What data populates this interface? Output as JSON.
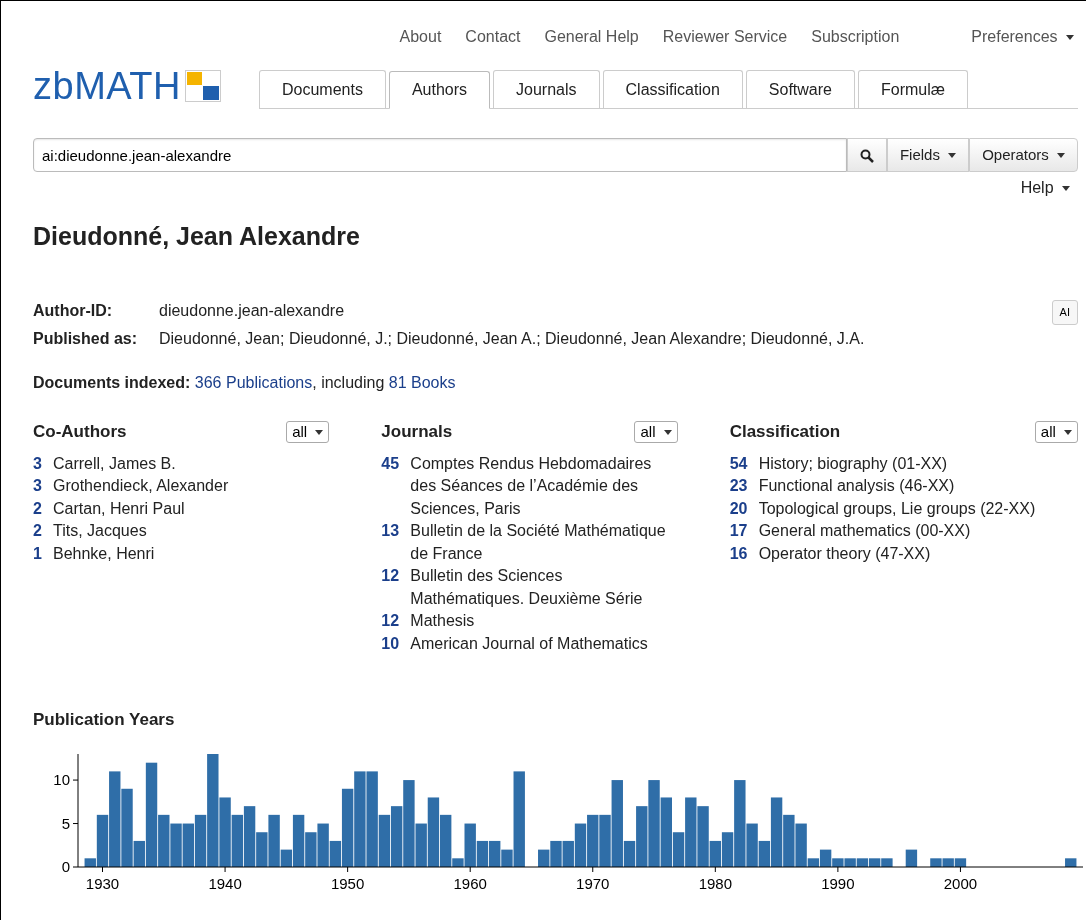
{
  "top_links": [
    "About",
    "Contact",
    "General Help",
    "Reviewer Service",
    "Subscription"
  ],
  "preferences": "Preferences",
  "logo": "zbMATH",
  "tabs": [
    {
      "label": "Documents",
      "selected": false
    },
    {
      "label": "Authors",
      "selected": true
    },
    {
      "label": "Journals",
      "selected": false
    },
    {
      "label": "Classification",
      "selected": false
    },
    {
      "label": "Software",
      "selected": false
    },
    {
      "label": "Formulæ",
      "selected": false
    }
  ],
  "search": {
    "value": "ai:dieudonne.jean-alexandre",
    "buttons": [
      "Fields",
      "Operators"
    ],
    "help": "Help"
  },
  "author": {
    "name": "Dieudonné, Jean Alexandre",
    "fields": [
      {
        "label": "Author-ID:",
        "value": "dieudonne.jean-alexandre"
      },
      {
        "label": "Published as:",
        "value": "Dieudonné, Jean; Dieudonné, J.; Dieudonné, Jean A.; Dieudonné, Jean Alexandre; Dieudonné, J.A."
      }
    ],
    "ai_button": "AI",
    "documents": {
      "label": "Documents indexed:",
      "publications": "366 Publications",
      "middle": ", including",
      "books": "81 Books"
    }
  },
  "columns": [
    {
      "title": "Co-Authors",
      "filter": "all",
      "items": [
        {
          "count": "3",
          "text": "Carrell, James B."
        },
        {
          "count": "3",
          "text": "Grothendieck, Alexander"
        },
        {
          "count": "2",
          "text": "Cartan, Henri Paul"
        },
        {
          "count": "2",
          "text": "Tits, Jacques"
        },
        {
          "count": "1",
          "text": "Behnke, Henri"
        }
      ]
    },
    {
      "title": "Journals",
      "filter": "all",
      "items": [
        {
          "count": "45",
          "text": "Comptes Rendus Hebdomadaires des Séances de l’Académie des Sciences, Paris"
        },
        {
          "count": "13",
          "text": "Bulletin de la Société Mathématique de France"
        },
        {
          "count": "12",
          "text": "Bulletin des Sciences Mathématiques. Deuxième Série"
        },
        {
          "count": "12",
          "text": "Mathesis"
        },
        {
          "count": "10",
          "text": "American Journal of Mathematics"
        }
      ]
    },
    {
      "title": "Classification",
      "filter": "all",
      "items": [
        {
          "count": "54",
          "text": "History; biography (01-XX)"
        },
        {
          "count": "23",
          "text": "Functional analysis (46-XX)"
        },
        {
          "count": "20",
          "text": "Topological groups, Lie groups (22-XX)"
        },
        {
          "count": "17",
          "text": "General mathematics (00-XX)"
        },
        {
          "count": "16",
          "text": "Operator theory (47-XX)"
        }
      ]
    }
  ],
  "publication_years": {
    "chart_data": {
      "type": "bar",
      "title": "Publication Years",
      "x": [
        1929,
        1930,
        1931,
        1932,
        1933,
        1934,
        1935,
        1936,
        1937,
        1938,
        1939,
        1940,
        1941,
        1942,
        1943,
        1944,
        1945,
        1946,
        1947,
        1948,
        1949,
        1950,
        1951,
        1952,
        1953,
        1954,
        1955,
        1956,
        1957,
        1958,
        1959,
        1960,
        1961,
        1962,
        1963,
        1964,
        1965,
        1966,
        1967,
        1968,
        1969,
        1970,
        1971,
        1972,
        1973,
        1974,
        1975,
        1976,
        1977,
        1978,
        1979,
        1980,
        1981,
        1982,
        1983,
        1984,
        1985,
        1986,
        1987,
        1988,
        1989,
        1990,
        1991,
        1992,
        1993,
        1994,
        1995,
        1996,
        1997,
        1998,
        1999,
        2000,
        2001,
        2002,
        2003,
        2004,
        2005,
        2006,
        2007,
        2008,
        2009
      ],
      "series": [
        {
          "color": "#2f6ea8",
          "values": [
            1,
            6,
            11,
            9,
            3,
            12,
            6,
            5,
            5,
            6,
            13,
            8,
            6,
            7,
            4,
            6,
            2,
            6,
            4,
            5,
            3,
            9,
            11,
            11,
            6,
            7,
            10,
            5,
            8,
            6,
            1,
            5,
            3,
            3,
            2,
            11,
            0,
            2,
            3,
            3,
            5,
            6,
            6,
            10,
            3,
            7,
            10,
            8,
            4,
            8,
            7,
            3,
            4,
            10,
            5,
            3,
            8,
            6,
            5,
            1,
            2,
            1,
            1,
            1,
            1,
            1,
            0,
            2,
            0,
            1,
            1,
            1,
            0,
            0,
            0,
            0,
            0,
            0,
            0,
            0,
            1
          ]
        }
      ],
      "xlim": [
        1928,
        2010
      ],
      "ylim": [
        0,
        13
      ],
      "yticks": [
        0,
        5,
        10
      ],
      "xticks": [
        1930,
        1940,
        1950,
        1960,
        1970,
        1980,
        1990,
        2000
      ]
    }
  }
}
